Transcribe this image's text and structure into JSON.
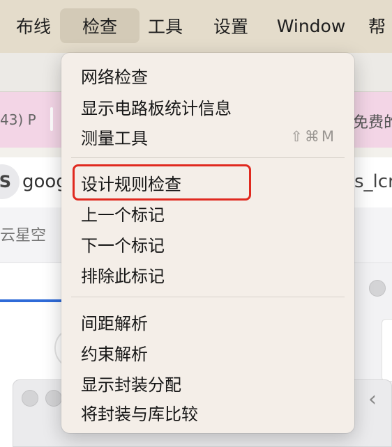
{
  "menubar": {
    "items": [
      "布线",
      "检查",
      "工具",
      "设置",
      "Window",
      "帮"
    ],
    "active_index": 1
  },
  "background": {
    "pink_left_text": "43) P",
    "pink_right_text": "免费的",
    "address_left_text": "goog",
    "address_right_text": "s_lcr",
    "address_icon_letter": "S",
    "subbar_text": "云星空",
    "chevron_icon": "chevron-left-icon"
  },
  "dropdown": {
    "items": [
      {
        "label": "网络检查"
      },
      {
        "label": "显示电路板统计信息"
      },
      {
        "label": "测量工具",
        "shortcut": "⇧⌘M"
      },
      {
        "label": "设计规则检查",
        "highlighted": true
      },
      {
        "label": "上一个标记"
      },
      {
        "label": "下一个标记"
      },
      {
        "label": "排除此标记"
      },
      {
        "label": "间距解析"
      },
      {
        "label": "约束解析"
      },
      {
        "label": "显示封装分配"
      },
      {
        "label": "将封装与库比较"
      }
    ]
  },
  "colors": {
    "menubar_bg": "#e4dccb",
    "menu_bg": "#f4eee8",
    "highlight_border": "#e0291f"
  }
}
